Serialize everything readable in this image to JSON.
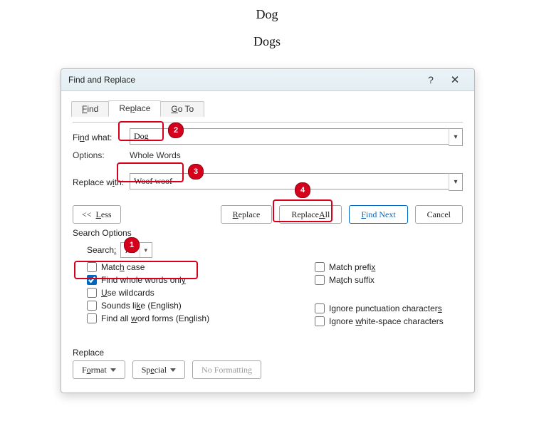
{
  "document": {
    "line1": "Dog",
    "line2": "Dogs"
  },
  "dialog": {
    "title": "Find and Replace",
    "tabs": {
      "find": "Find",
      "replace": "Replace",
      "goto": "Go To"
    },
    "find_what_label": "Find what:",
    "find_what_value": "Dog",
    "options_label": "Options:",
    "options_value": "Whole Words",
    "replace_with_label": "Replace with:",
    "replace_with_value": "Woof woof",
    "buttons": {
      "less": "<<  Less",
      "replace": "Replace",
      "replace_all": "Replace All",
      "find_next": "Find Next",
      "cancel": "Cancel"
    },
    "search_options_title": "Search Options",
    "search_label": "Search:",
    "search_value": "All",
    "checkboxes": {
      "match_case": "Match case",
      "whole_words": "Find whole words only",
      "wildcards": "Use wildcards",
      "sounds_like": "Sounds like (English)",
      "word_forms": "Find all word forms (English)",
      "match_prefix": "Match prefix",
      "match_suffix": "Match suffix",
      "ignore_punct": "Ignore punctuation characters",
      "ignore_ws": "Ignore white-space characters"
    },
    "bottom": {
      "section": "Replace",
      "format": "Format",
      "special": "Special",
      "no_formatting": "No Formatting"
    }
  },
  "callouts": {
    "c1": "1",
    "c2": "2",
    "c3": "3",
    "c4": "4"
  }
}
